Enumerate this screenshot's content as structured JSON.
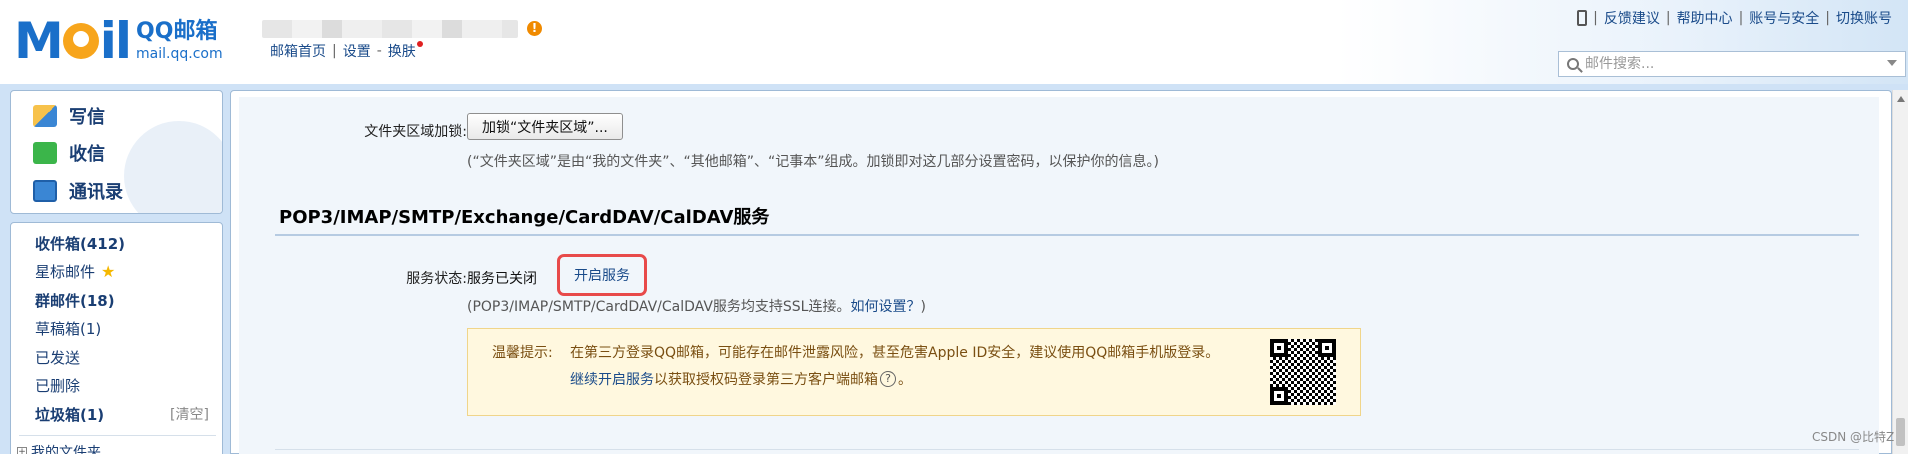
{
  "header": {
    "logo_moil": "M il",
    "logo_title": "QQ邮箱",
    "logo_domain": "mail.qq.com",
    "warn_icon": "!",
    "links": [
      "邮箱首页",
      "设置",
      "换肤"
    ],
    "separators": [
      "|",
      "-"
    ],
    "top_right": [
      "反馈建议",
      "帮助中心",
      "账号与安全",
      "切换账号"
    ],
    "top_sep": "|",
    "search_placeholder": "邮件搜索..."
  },
  "sidebar": {
    "buttons": [
      "写信",
      "收信",
      "通讯录"
    ],
    "folders": {
      "inbox": "收件箱(412)",
      "starred": "星标邮件",
      "starred_icon": "★",
      "group": "群邮件(18)",
      "drafts": "草稿箱(1)",
      "sent": "已发送",
      "deleted": "已删除",
      "junk": "垃圾箱(1)",
      "clear": "[清空]",
      "my_folders": "我的文件夹",
      "my_folders_toggle": "+"
    }
  },
  "main": {
    "lock_label": "文件夹区域加锁:",
    "lock_button": "加锁“文件夹区域”...",
    "lock_desc": "(“文件夹区域”是由“我的文件夹”、“其他邮箱”、“记事本”组成。加锁即对这几部分设置密码，以保护你的信息。)",
    "section_title": "POP3/IMAP/SMTP/Exchange/CardDAV/CalDAV服务",
    "status_label": "服务状态:",
    "status_value": "服务已关闭",
    "enable_link": "开启服务",
    "ssl_note_prefix": "(POP3/IMAP/SMTP/CardDAV/CalDAV服务均支持SSL连接。",
    "ssl_note_link": "如何设置？",
    "ssl_note_suffix": ")",
    "tip_label": "温馨提示:",
    "tip_line1": "在第三方登录QQ邮箱，可能存在邮件泄露风险，甚至危害Apple ID安全，建议使用QQ邮箱手机版登录。",
    "tip_line2_link": "继续开启服务",
    "tip_line2_text": "以获取授权码登录第三方客户端邮箱",
    "tip_line2_icon": "?",
    "tip_line2_end": "。"
  },
  "watermark": "CSDN @比特Z",
  "colors": {
    "link": "#1a4b8a",
    "highlight_border": "#e84a4a",
    "tip_bg": "#fff8df",
    "brand": "#1a6fc9"
  }
}
